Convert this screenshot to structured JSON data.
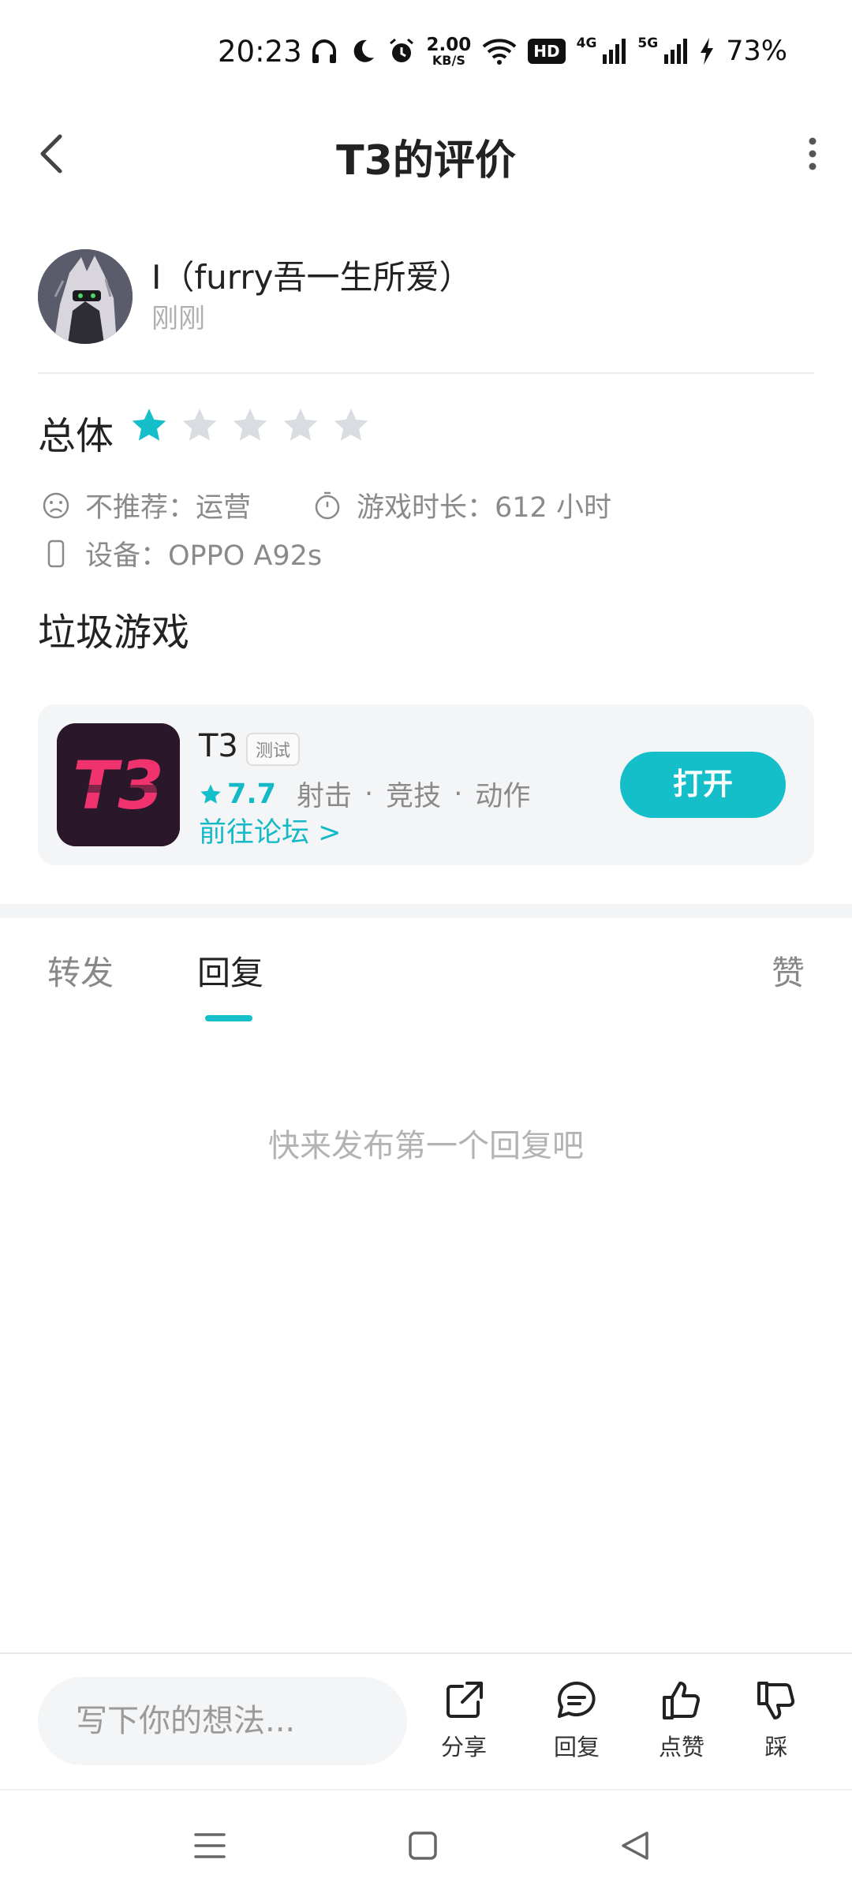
{
  "status_bar": {
    "time": "20:23",
    "net_speed_value": "2.00",
    "net_speed_unit": "KB/S",
    "hd_label": "HD",
    "sig1_label": "4G",
    "sig2_label": "5G",
    "battery": "73%"
  },
  "header": {
    "title": "T3的评价"
  },
  "author": {
    "name": "I（furry吾一生所爱）",
    "time": "刚刚"
  },
  "rating": {
    "label": "总体",
    "stars": 1,
    "max_stars": 5,
    "accent": "#15bfc9",
    "empty_color": "#d9dde1"
  },
  "meta": {
    "recommend": "不推荐：运营",
    "playtime": "游戏时长：612 小时",
    "device": "设备：OPPO A92s"
  },
  "review": {
    "text": "垃圾游戏"
  },
  "game": {
    "icon_text": "T3",
    "name": "T3",
    "badge": "测试",
    "score": "7.7",
    "tags": [
      "射击",
      "竞技",
      "动作"
    ],
    "forum_link": "前往论坛 >",
    "open_label": "打开"
  },
  "tabs": {
    "forward": "转发",
    "reply": "回复",
    "like": "赞"
  },
  "empty_state": "快来发布第一个回复吧",
  "bottom_bar": {
    "input_placeholder": "写下你的想法...",
    "share": "分享",
    "reply": "回复",
    "like": "点赞",
    "dislike": "踩"
  }
}
